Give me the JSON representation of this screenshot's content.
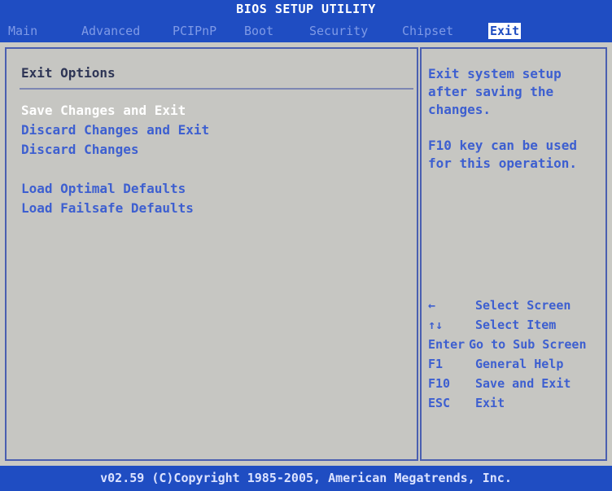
{
  "title": "BIOS SETUP UTILITY",
  "tabs": [
    {
      "label": "Main"
    },
    {
      "label": "Advanced"
    },
    {
      "label": "PCIPnP"
    },
    {
      "label": "Boot"
    },
    {
      "label": "Security"
    },
    {
      "label": "Chipset"
    },
    {
      "label": "Exit"
    }
  ],
  "active_tab": "Exit",
  "section_title": "Exit Options",
  "menu": [
    {
      "label": "Save Changes and Exit",
      "selected": true
    },
    {
      "label": "Discard Changes and Exit"
    },
    {
      "label": "Discard Changes"
    },
    {
      "label": "Load Optimal Defaults"
    },
    {
      "label": "Load Failsafe Defaults"
    }
  ],
  "help": {
    "line1": "Exit system setup after saving the changes.",
    "line2": "F10 key can be used for this operation."
  },
  "keys": [
    {
      "key": "←",
      "action": "Select Screen"
    },
    {
      "key": "↑↓",
      "action": "Select Item"
    },
    {
      "key": "Enter",
      "action": "Go to Sub Screen"
    },
    {
      "key": "F1",
      "action": "General Help"
    },
    {
      "key": "F10",
      "action": "Save and Exit"
    },
    {
      "key": "ESC",
      "action": "Exit"
    }
  ],
  "footer": "v02.59 (C)Copyright 1985-2005, American Megatrends, Inc.",
  "colors": {
    "header_blue": "#1f4dc2",
    "panel_gray": "#c6c6c2",
    "item_blue": "#3d5fd0",
    "selected_white": "#ffffff"
  }
}
